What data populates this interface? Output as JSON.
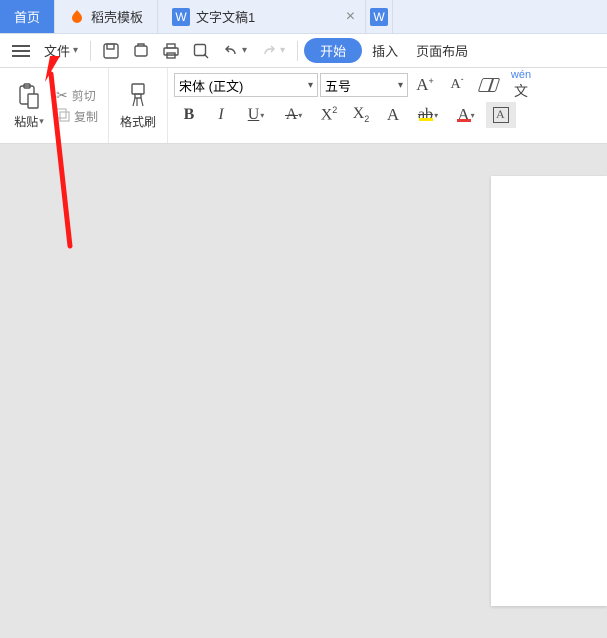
{
  "tabs": {
    "home": "首页",
    "docshell": "稻壳模板",
    "doc1": "文字文稿1"
  },
  "menubar": {
    "file": "文件",
    "start": "开始",
    "insert": "插入",
    "pagelayout": "页面布局"
  },
  "clipboard": {
    "paste": "粘贴",
    "cut": "剪切",
    "copy": "复制",
    "formatpainter": "格式刷"
  },
  "font": {
    "name": "宋体 (正文)",
    "size": "五号"
  },
  "icons": {
    "wen_pinyin": "wén",
    "wen_char": "文"
  }
}
